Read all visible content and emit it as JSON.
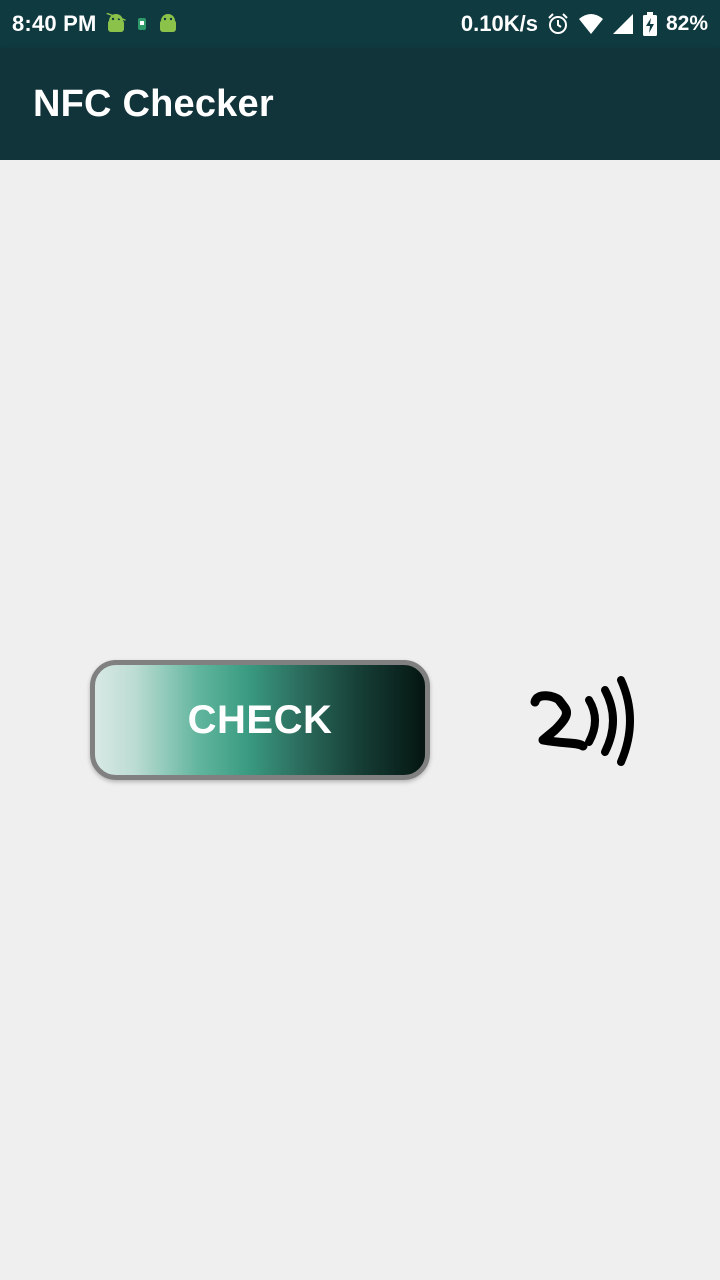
{
  "status_bar": {
    "time": "8:40 PM",
    "net_speed": "0.10K/s",
    "battery_percent": "82%",
    "notification_icons": [
      "android-icon",
      "sim-icon",
      "android-icon"
    ],
    "system_icons": [
      "alarm-icon",
      "wifi-icon",
      "signal-icon",
      "battery-charging-icon"
    ],
    "colors": {
      "background": "#0f3a40"
    }
  },
  "app_bar": {
    "title": "NFC Checker",
    "colors": {
      "background": "#11333a"
    }
  },
  "main": {
    "check_button_label": "CHECK",
    "nfc_icon": "nfc-icon"
  }
}
